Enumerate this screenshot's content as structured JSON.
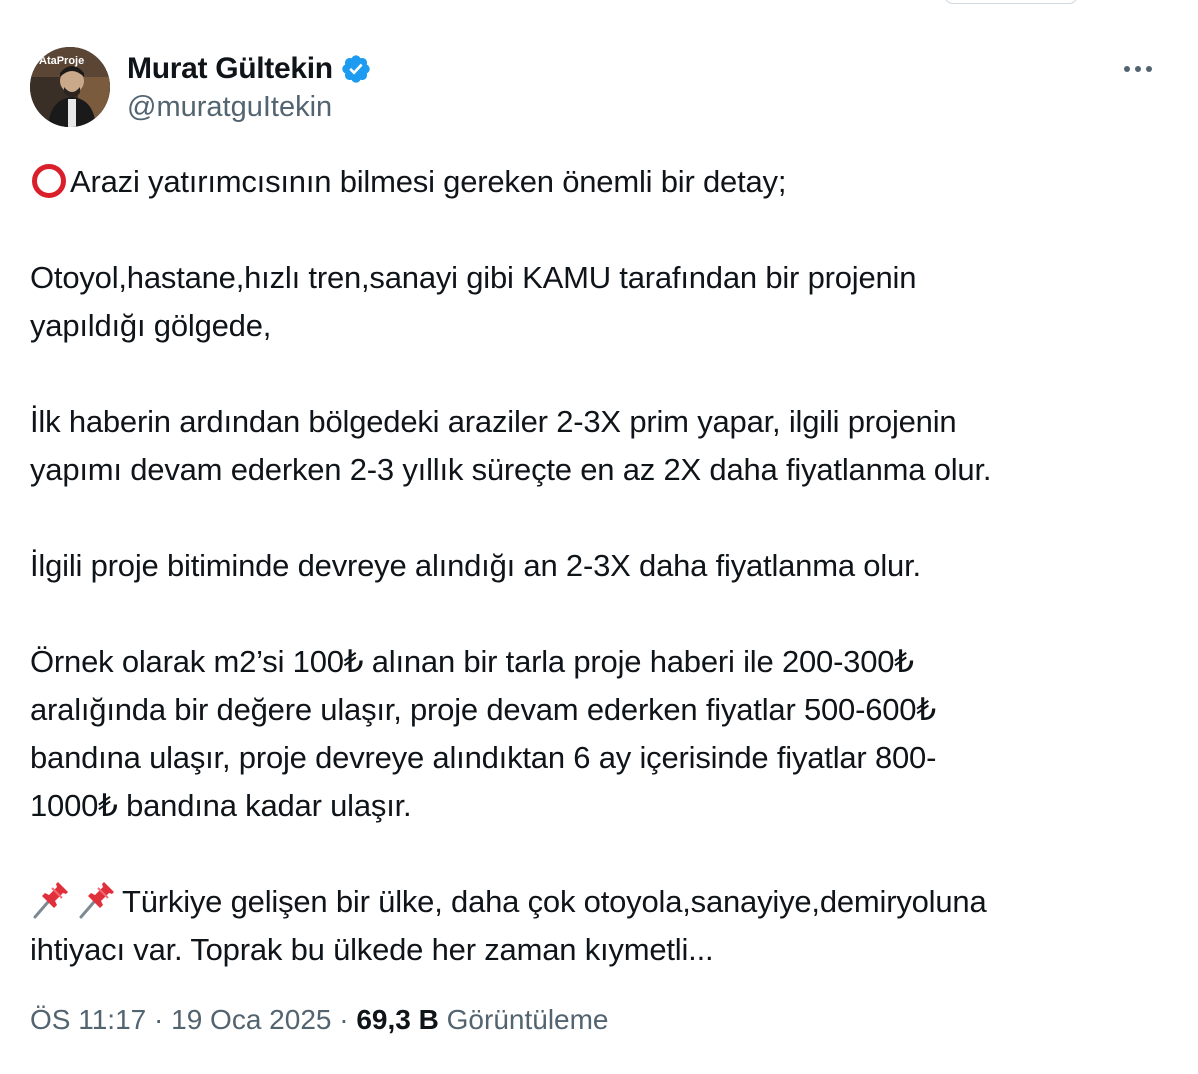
{
  "author": {
    "display_name": "Murat Gültekin",
    "handle": "@muratguItekin",
    "verified": true,
    "avatar_text": "AtaProje"
  },
  "tweet": {
    "paragraphs": [
      {
        "prefix_icon": "hollow-red-circle-icon",
        "text": "Arazi yatırımcısının bilmesi gereken önemli bir detay;"
      },
      {
        "prefix_icon": null,
        "text": "Otoyol,hastane,hızlı tren,sanayi gibi KAMU tarafından bir projenin\nyapıldığı gölgede,"
      },
      {
        "prefix_icon": null,
        "text": "İlk haberin ardından bölgedeki araziler 2-3X prim yapar, ilgili projenin\nyapımı devam ederken 2-3 yıllık süreçte en az 2X daha fiyatlanma olur."
      },
      {
        "prefix_icon": null,
        "text": "İlgili proje bitiminde devreye alındığı an 2-3X daha fiyatlanma olur."
      },
      {
        "prefix_icon": null,
        "text": "Örnek olarak m2’si 100₺ alınan bir tarla proje haberi ile 200-300₺\naralığında bir değere ulaşır, proje devam ederken fiyatlar 500-600₺\nbandına ulaşır, proje devreye alındıktan 6 ay içerisinde fiyatlar 800-\n1000₺ bandına kadar ulaşır."
      },
      {
        "prefix_icon": "pushpin-icon",
        "text": "Türkiye gelişen bir ülke, daha çok otoyola,sanayiye,demiryoluna\nihtiyacı var. Toprak bu ülkede her zaman kıymetli..."
      }
    ]
  },
  "meta": {
    "time": "ÖS 11:17",
    "separator": " · ",
    "date": "19 Oca 2025",
    "views_count": "69,3 B",
    "views_label": "Görüntüleme"
  },
  "colors": {
    "text": "#0f1419",
    "secondary": "#536471",
    "verified_blue": "#1d9bf0",
    "emoji_red": "#d81f2a"
  }
}
